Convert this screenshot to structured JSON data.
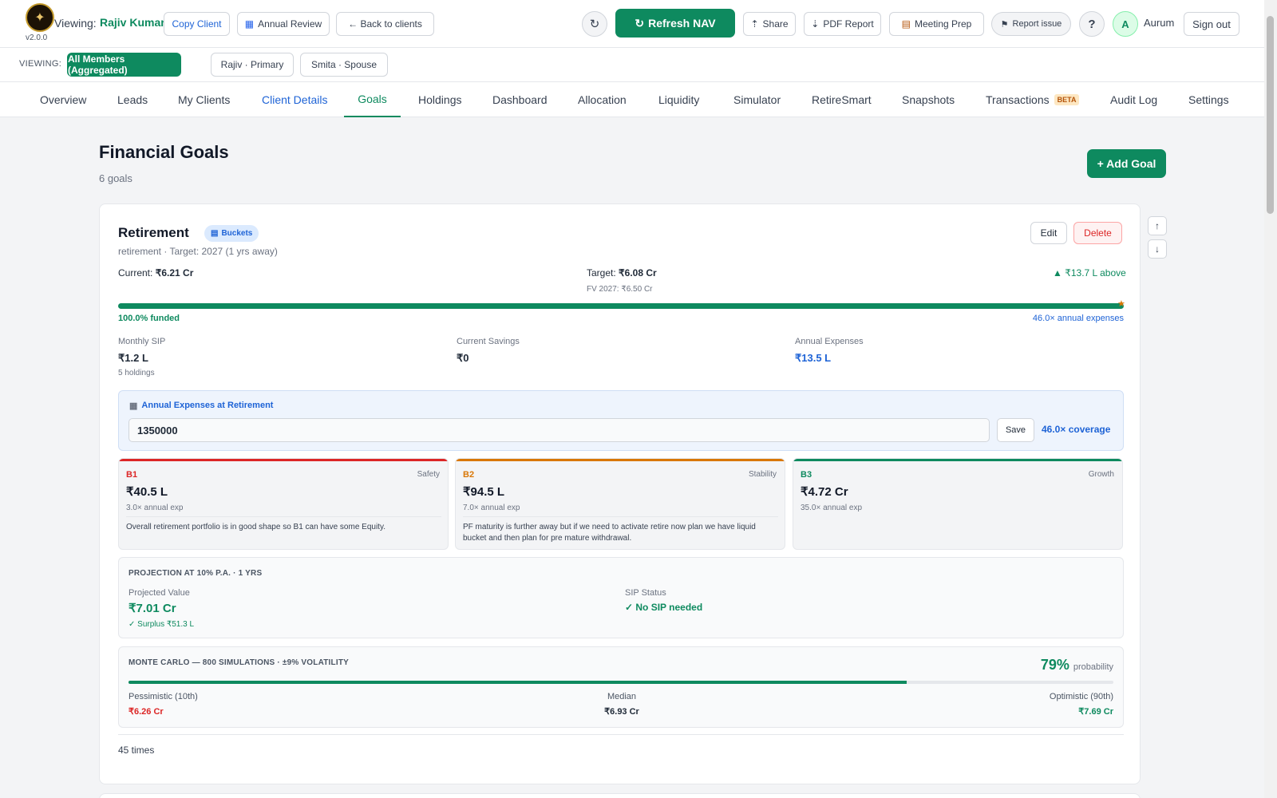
{
  "header": {
    "version": "v2.0.0",
    "viewing_label": "Viewing:",
    "client_name": "Rajiv Kumar",
    "copy_client": "Copy Client",
    "annual_review": "Annual Review",
    "back_to_clients": "← Back to clients",
    "refresh_nav": "Refresh NAV",
    "share": "Share",
    "pdf_report": "PDF Report",
    "meeting_prep": "Meeting Prep",
    "report_issue": "Report issue",
    "help": "?",
    "avatar_initial": "A",
    "username": "Aurum",
    "sign_out": "Sign out"
  },
  "members": {
    "label": "VIEWING:",
    "items": [
      "All Members (Aggregated)",
      "Rajiv · Primary",
      "Smita · Spouse"
    ]
  },
  "nav": {
    "tabs": [
      "Overview",
      "Leads",
      "My Clients",
      "Client Details",
      "Goals",
      "Holdings",
      "Dashboard",
      "Allocation",
      "Liquidity",
      "Simulator",
      "RetireSmart",
      "Snapshots",
      "Transactions",
      "Audit Log",
      "Settings"
    ],
    "beta_badge": "BETA",
    "active": "Goals"
  },
  "page": {
    "title": "Financial Goals",
    "subtitle": "6 goals",
    "add_goal": "+ Add Goal"
  },
  "goal": {
    "name": "Retirement",
    "badge": "Buckets",
    "meta": "retirement · Target: 2027 (1 yrs away)",
    "edit": "Edit",
    "delete": "Delete",
    "current_label": "Current:",
    "current_value": "₹6.21 Cr",
    "target_label": "Target:",
    "target_value": "₹6.08 Cr",
    "fv": "FV 2027: ₹6.50 Cr",
    "delta": "▲ ₹13.7 L above",
    "funded_pct": 100,
    "funded_text": "100.0% funded",
    "annual_multiple": "46.0× annual expenses",
    "stats": [
      {
        "label": "Monthly SIP",
        "value": "₹1.2 L",
        "sub": "5 holdings"
      },
      {
        "label": "Current Savings",
        "value": "₹0",
        "sub": ""
      },
      {
        "label": "Annual Expenses",
        "value": "₹13.5 L",
        "sub": ""
      }
    ],
    "expenses_box": {
      "title": "Annual Expenses at Retirement",
      "input_value": "1350000",
      "save": "Save",
      "coverage": "46.0× coverage"
    },
    "buckets": [
      {
        "code": "B1",
        "kind": "Safety",
        "amount": "₹40.5 L",
        "multiple": "3.0× annual exp",
        "note": "Overall retirement portfolio is in good shape so B1 can have some Equity.",
        "color": "#dc2626"
      },
      {
        "code": "B2",
        "kind": "Stability",
        "amount": "₹94.5 L",
        "multiple": "7.0× annual exp",
        "note": "PF maturity is further away but if we need to activate retire now plan we have liquid bucket and then plan for pre mature withdrawal.",
        "color": "#d97706"
      },
      {
        "code": "B3",
        "kind": "Growth",
        "amount": "₹4.72 Cr",
        "multiple": "35.0× annual exp",
        "note": "",
        "color": "#0e8a5f"
      }
    ],
    "projection": {
      "title": "PROJECTION AT 10% P.A. · 1 YRS",
      "projected_label": "Projected Value",
      "projected_value": "₹7.01 Cr",
      "surplus": "✓ Surplus ₹51.3 L",
      "sip_label": "SIP Status",
      "sip_value": "✓ No SIP needed"
    },
    "monte_carlo": {
      "title": "MONTE CARLO — 800 SIMULATIONS · ±9% VOLATILITY",
      "probability": "79%",
      "probability_value": 79,
      "probability_label": "probability",
      "pessimistic_label": "Pessimistic (10th)",
      "pessimistic_value": "₹6.26 Cr",
      "median_label": "Median",
      "median_value": "₹6.93 Cr",
      "optimistic_label": "Optimistic (90th)",
      "optimistic_value": "₹7.69 Cr"
    },
    "footer_note": "45 times"
  },
  "colors": {
    "brand": "#0e8a5f",
    "link": "#1e63d6",
    "danger": "#dc2626"
  }
}
